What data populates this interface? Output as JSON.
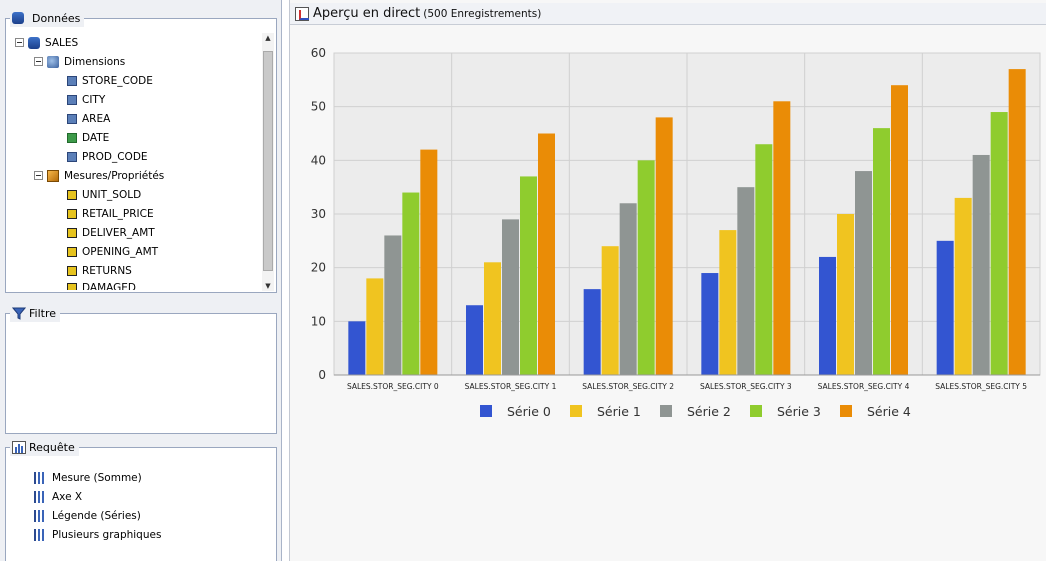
{
  "data_panel": {
    "title": "Données",
    "tree": {
      "root": "SALES",
      "dimensions_label": "Dimensions",
      "dimensions": [
        "STORE_CODE",
        "CITY",
        "AREA",
        "DATE",
        "PROD_CODE"
      ],
      "measures_label": "Mesures/Propriétés",
      "measures": [
        "UNIT_SOLD",
        "RETAIL_PRICE",
        "DELIVER_AMT",
        "OPENING_AMT",
        "RETURNS",
        "DAMAGED"
      ]
    }
  },
  "filter_panel": {
    "title": "Filtre"
  },
  "query_panel": {
    "title": "Requête",
    "items": [
      "Mesure (Somme)",
      "Axe X",
      "Légende (Séries)",
      "Plusieurs graphiques"
    ]
  },
  "preview": {
    "title": "Aperçu en direct",
    "subtitle": "(500 Enregistrements)"
  },
  "chart_data": {
    "type": "bar",
    "categories": [
      "SALES.STOR_SEG.CITY 0",
      "SALES.STOR_SEG.CITY 1",
      "SALES.STOR_SEG.CITY 2",
      "SALES.STOR_SEG.CITY 3",
      "SALES.STOR_SEG.CITY 4",
      "SALES.STOR_SEG.CITY 5"
    ],
    "series": [
      {
        "name": "Série 0",
        "color": "#3355d1",
        "values": [
          10,
          13,
          16,
          19,
          22,
          25
        ]
      },
      {
        "name": "Série 1",
        "color": "#f0c420",
        "values": [
          18,
          21,
          24,
          27,
          30,
          33
        ]
      },
      {
        "name": "Série 2",
        "color": "#8f9593",
        "values": [
          26,
          29,
          32,
          35,
          38,
          41
        ]
      },
      {
        "name": "Série 3",
        "color": "#8fcc2e",
        "values": [
          34,
          37,
          40,
          43,
          46,
          49
        ]
      },
      {
        "name": "Série 4",
        "color": "#ea8c06",
        "values": [
          42,
          45,
          48,
          51,
          54,
          57
        ]
      }
    ],
    "yticks": [
      0,
      10,
      20,
      30,
      40,
      50,
      60
    ],
    "ylim": [
      0,
      60
    ],
    "grid": true,
    "legend": "bottom"
  }
}
